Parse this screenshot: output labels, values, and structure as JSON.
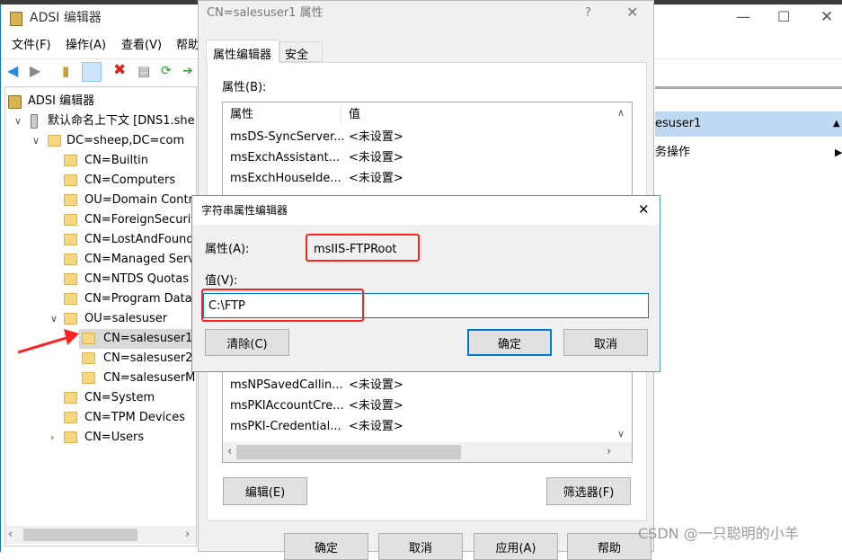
{
  "main_window": {
    "title": "ADSI 编辑器",
    "menu": [
      "文件(F)",
      "操作(A)",
      "查看(V)",
      "帮助"
    ],
    "tree": [
      {
        "label": "ADSI 编辑器",
        "level": 0,
        "icon": "adsi-icon"
      },
      {
        "label": "默认命名上下文 [DNS1.she",
        "level": 1,
        "icon": "server-icon",
        "expanded": true
      },
      {
        "label": "DC=sheep,DC=com",
        "level": 2,
        "icon": "folder-icon",
        "expanded": true
      },
      {
        "label": "CN=Builtin",
        "level": 3
      },
      {
        "label": "CN=Computers",
        "level": 3
      },
      {
        "label": "OU=Domain Contr",
        "level": 3
      },
      {
        "label": "CN=ForeignSecurit",
        "level": 3
      },
      {
        "label": "CN=LostAndFound",
        "level": 3
      },
      {
        "label": "CN=Managed Serv",
        "level": 3
      },
      {
        "label": "CN=NTDS Quotas",
        "level": 3
      },
      {
        "label": "CN=Program Data",
        "level": 3
      },
      {
        "label": "OU=salesuser",
        "level": 3,
        "expanded": true
      },
      {
        "label": "CN=salesuser1",
        "level": 4,
        "selected": true
      },
      {
        "label": "CN=salesuser2",
        "level": 4
      },
      {
        "label": "CN=salesuserM",
        "level": 4
      },
      {
        "label": "CN=System",
        "level": 3
      },
      {
        "label": "CN=TPM Devices",
        "level": 3
      },
      {
        "label": "CN=Users",
        "level": 3,
        "collapsed": true
      }
    ],
    "actions": {
      "header": "esuser1",
      "more": "务操作"
    }
  },
  "properties_dialog": {
    "title": "CN=salesuser1 属性",
    "help": "?",
    "tabs": [
      "属性编辑器",
      "安全"
    ],
    "list_label": "属性(B):",
    "columns": [
      "属性",
      "值"
    ],
    "rows_top": [
      [
        "msDS-SyncServer...",
        "<未设置>"
      ],
      [
        "msExchAssistant...",
        "<未设置>"
      ],
      [
        "msExchHouseIde...",
        "<未设置>"
      ]
    ],
    "rows_bottom": [
      [
        "msNPSavedCallin...",
        "<未设置>"
      ],
      [
        "msPKIAccountCre...",
        "<未设置>"
      ],
      [
        "msPKI-Credential...",
        "<未设置>"
      ]
    ],
    "edit": "编辑(E)",
    "filter": "筛选器(F)",
    "ok": "确定",
    "cancel": "取消",
    "apply": "应用(A)",
    "helpbtn": "帮助"
  },
  "string_editor": {
    "title": "字符串属性编辑器",
    "attr_label": "属性(A):",
    "attr_value": "msIIS-FTPRoot",
    "value_label": "值(V):",
    "value": "C:\\FTP",
    "clear": "清除(C)",
    "ok": "确定",
    "cancel": "取消"
  },
  "watermark": "CSDN @一只聪明的小羊",
  "colors": {
    "highlight": "#ff2020",
    "accent": "#0078d7",
    "selected": "#cce8ff"
  }
}
